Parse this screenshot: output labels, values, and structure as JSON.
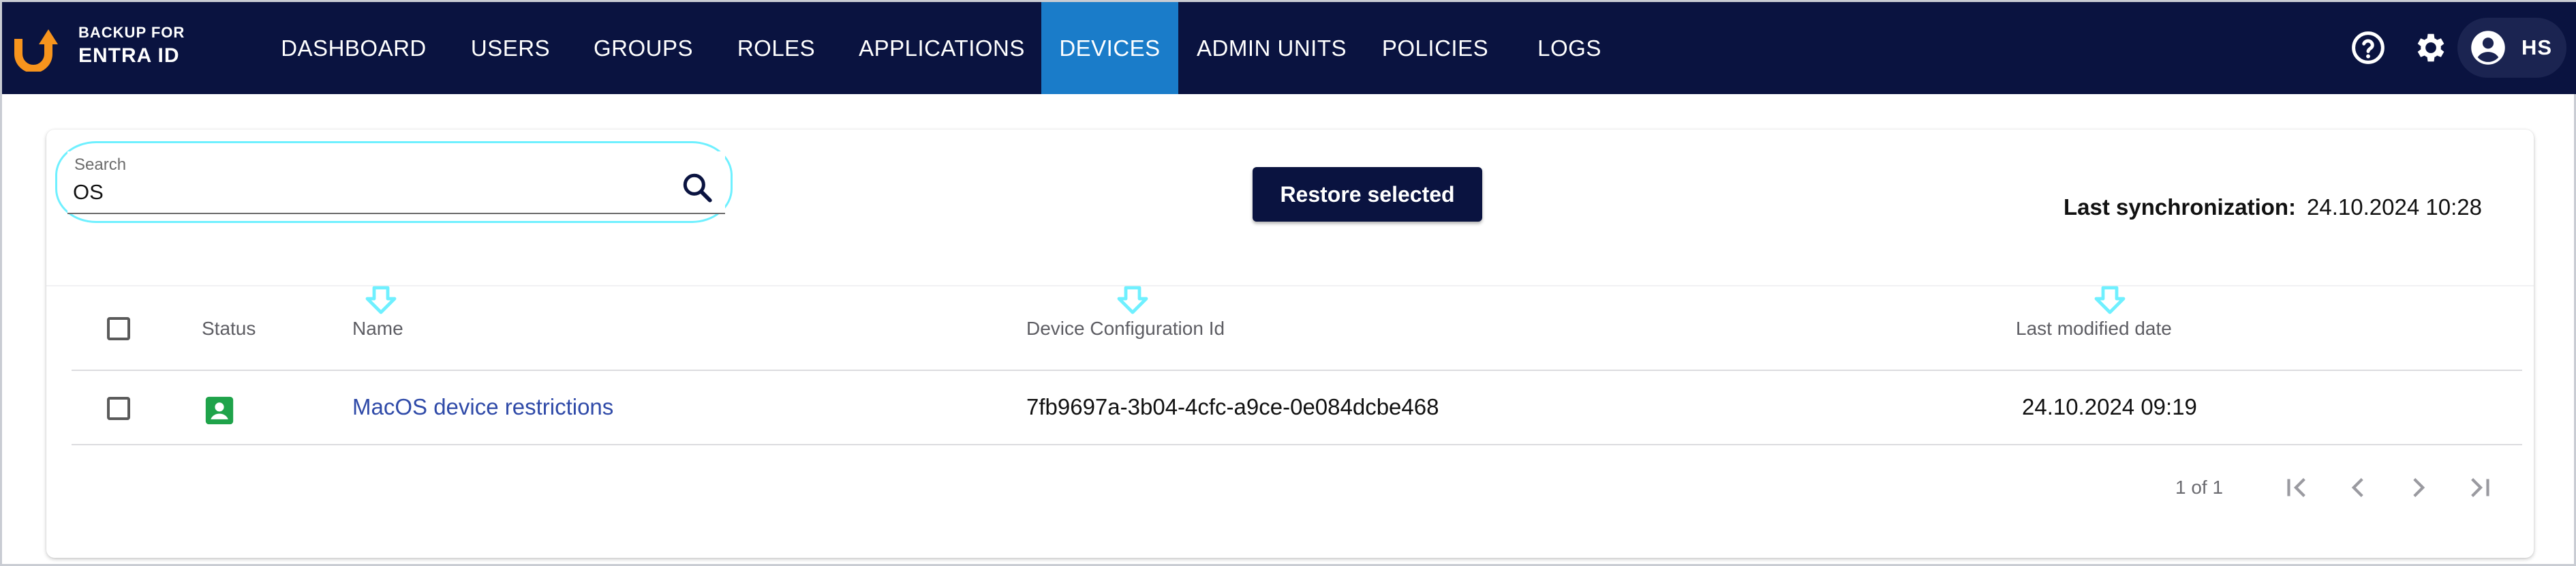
{
  "app": {
    "brand_line1": "BACKUP FOR",
    "brand_line2": "ENTRA ID",
    "brand_color": "#f7941d"
  },
  "nav": {
    "items": [
      {
        "label": "DASHBOARD"
      },
      {
        "label": "USERS"
      },
      {
        "label": "GROUPS"
      },
      {
        "label": "ROLES"
      },
      {
        "label": "APPLICATIONS"
      },
      {
        "label": "DEVICES"
      },
      {
        "label": "ADMIN UNITS"
      },
      {
        "label": "POLICIES"
      },
      {
        "label": "LOGS"
      }
    ],
    "active": "DEVICES",
    "active_color": "#1a7cc9",
    "bar_color": "#0a1340"
  },
  "header_icons": [
    "help-circle-icon",
    "gear-icon",
    "account-circle-icon"
  ],
  "user": {
    "initials": "HS"
  },
  "search": {
    "label": "Search",
    "value": "OS",
    "icon": "search-icon"
  },
  "toolbar": {
    "restore_label": "Restore selected"
  },
  "sync": {
    "label": "Last synchronization:",
    "value": "24.10.2024 10:28"
  },
  "table": {
    "columns": {
      "status": "Status",
      "name": "Name",
      "device_config_id": "Device Configuration Id",
      "last_modified": "Last modified date"
    },
    "rows": [
      {
        "status_icon": "account-box-icon",
        "status_color": "#1fa34a",
        "name": "MacOS device restrictions",
        "device_config_id": "7fb9697a-3b04-4cfc-a9ce-0e084dcbe468",
        "last_modified": "24.10.2024 09:19"
      }
    ]
  },
  "pagination": {
    "text": "1 of 1",
    "buttons": [
      "first-page-icon",
      "previous-page-icon",
      "next-page-icon",
      "last-page-icon"
    ]
  }
}
